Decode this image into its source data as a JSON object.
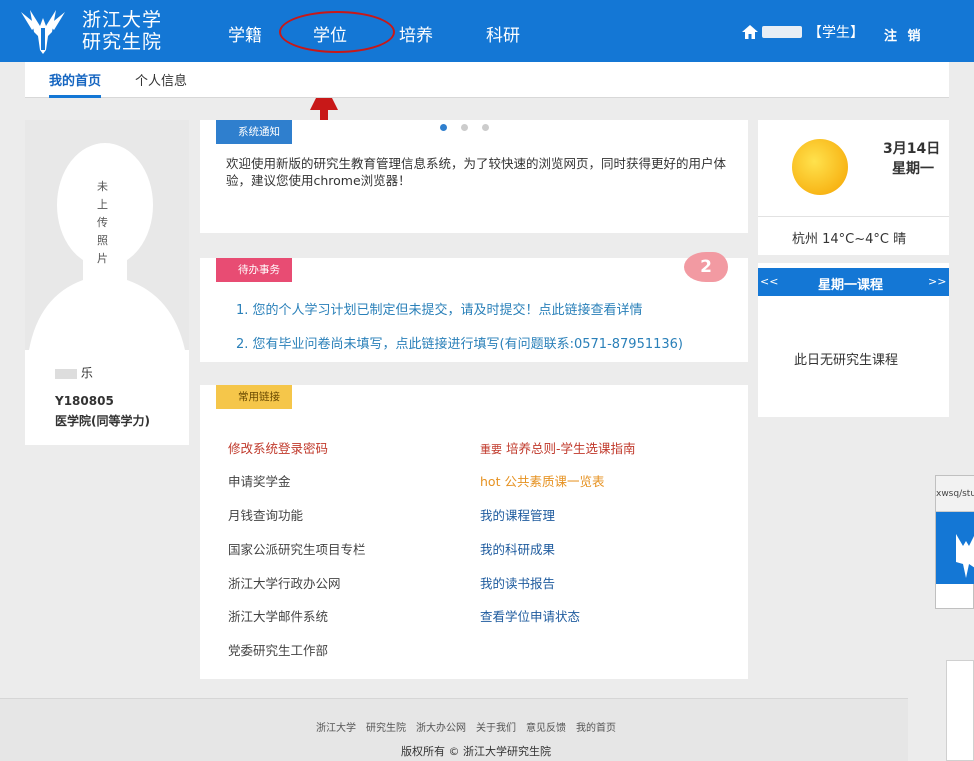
{
  "header": {
    "logo_text": [
      "浙江大学",
      "研究生院"
    ],
    "nav": [
      "学籍",
      "学位",
      "培养",
      "科研"
    ],
    "user_role": "【学生】",
    "logout": "注 销"
  },
  "subnav": {
    "tabs": [
      "我的首页",
      "个人信息"
    ],
    "active": "我的首页"
  },
  "profile": {
    "photo_placeholder": [
      "未",
      "上",
      "传",
      "照",
      "片"
    ],
    "name_suffix": "乐",
    "student_id": "Y180805",
    "college": "医学院(同等学力)"
  },
  "notice": {
    "label": "系统通知",
    "text": "欢迎使用新版的研究生教育管理信息系统，为了较快速的浏览网页，同时获得更好的用户体验，建议您使用chrome浏览器！"
  },
  "todo": {
    "label": "待办事务",
    "count": "2",
    "items": [
      "1. 您的个人学习计划已制定但未提交，请及时提交！点此链接查看详情",
      "2. 您有毕业问卷尚未填写，点此链接进行填写(有问题联系:0571-87951136)"
    ]
  },
  "links": {
    "label": "常用链接",
    "left": [
      "修改系统登录密码",
      "申请奖学金",
      "月钱查询功能",
      "国家公派研究生项目专栏",
      "浙江大学行政办公网",
      "浙江大学邮件系统",
      "党委研究生工作部"
    ],
    "right_tag_0": "重要",
    "right_0": "培养总则-学生选课指南",
    "right_tag_1": "hot",
    "right_1": "公共素质课一览表",
    "right": [
      "我的课程管理",
      "我的科研成果",
      "我的读书报告",
      "查看学位申请状态"
    ]
  },
  "weather": {
    "date": "3月14日",
    "weekday": "星期一",
    "city_temp": "杭州 14°C~4°C 晴"
  },
  "course": {
    "prev": "<<",
    "title": "星期一课程",
    "next": ">>",
    "empty": "此日无研究生课程"
  },
  "overlay": {
    "url_fragment": "xwsq/stu_degre"
  },
  "footer": {
    "links": [
      "浙江大学",
      "研究生院",
      "浙大办公网",
      "关于我们",
      "意见反馈",
      "我的首页"
    ],
    "copyright": "版权所有 © 浙江大学研究生院"
  },
  "colors": {
    "brand_blue": "#1477d5",
    "annotation_red": "#c81818",
    "todo_pink": "#e84c73",
    "link_yellow": "#f5c64a"
  }
}
